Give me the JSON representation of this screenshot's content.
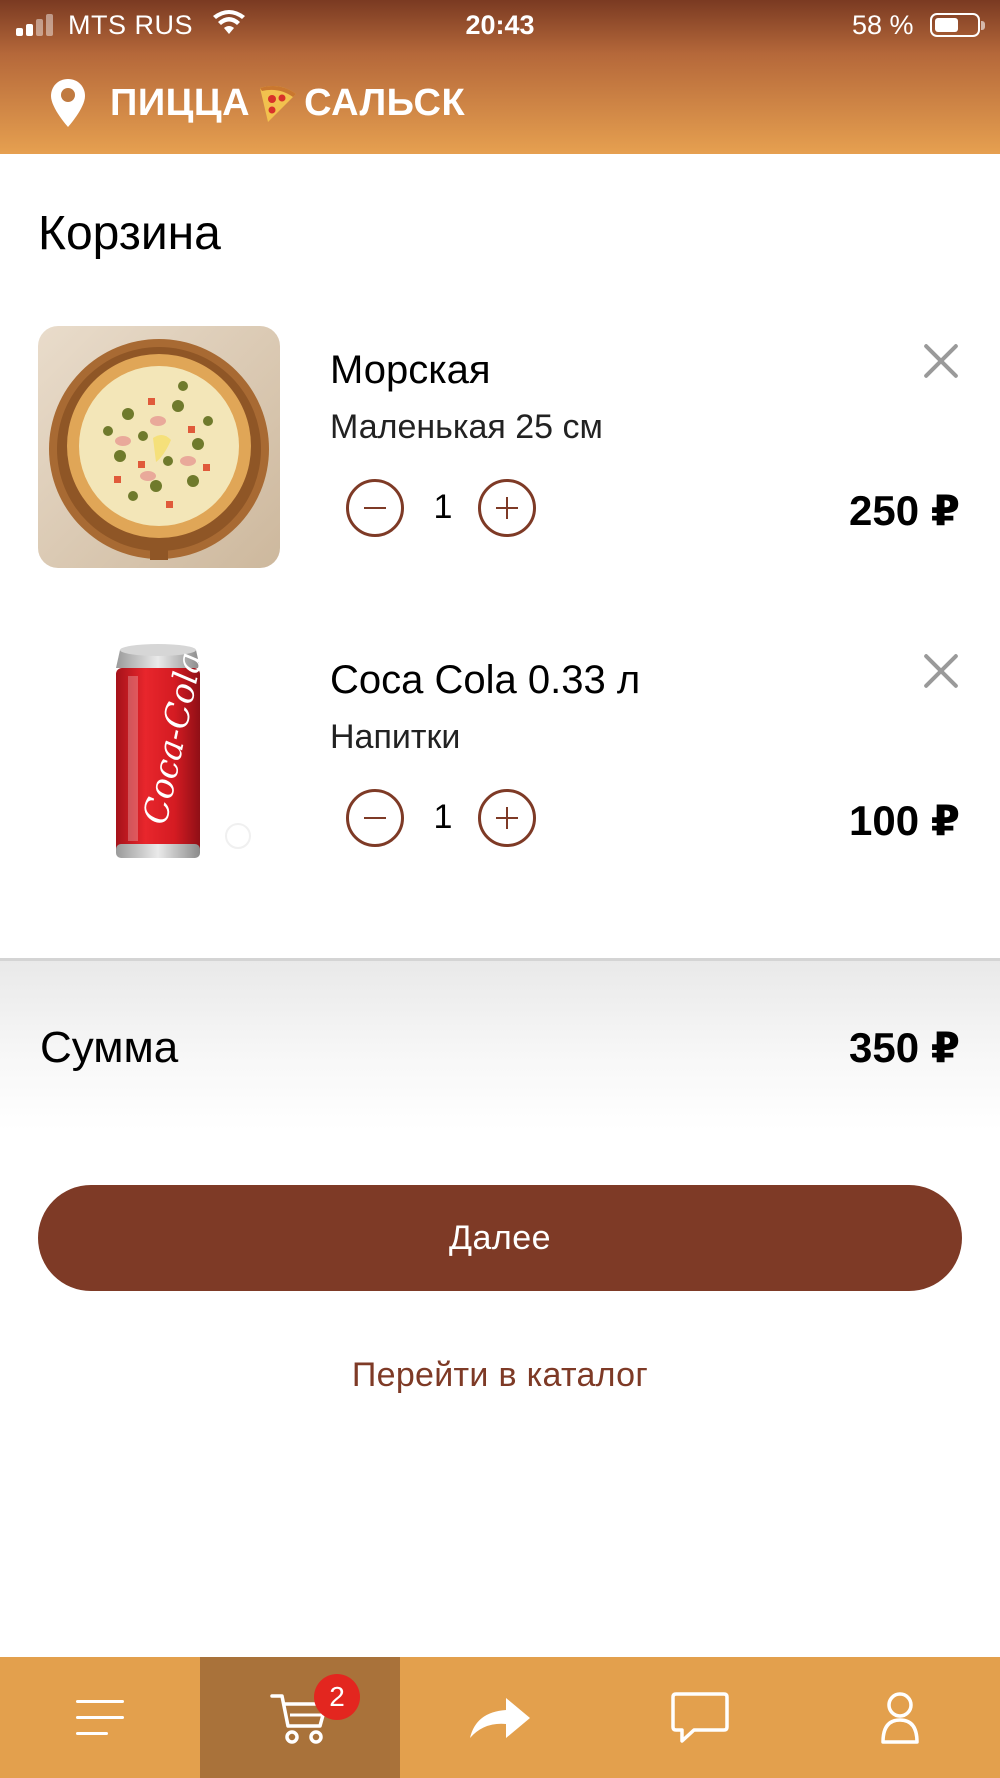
{
  "status_bar": {
    "carrier": "MTS RUS",
    "time": "20:43",
    "battery": "58 %",
    "battery_level": 0.58
  },
  "header": {
    "brand_left": "ПИЦЦА",
    "brand_right": "САЛЬСК",
    "location_icon": "location-pin-icon",
    "brand_icon": "pizza-slice-icon"
  },
  "page": {
    "title": "Корзина"
  },
  "cart": {
    "items": [
      {
        "name": "Морская",
        "subtitle": "Маленькая 25 см",
        "quantity": "1",
        "price": "250 ₽",
        "image": "pizza-photo"
      },
      {
        "name": "Coca Cola 0.33 л",
        "subtitle": "Напитки",
        "quantity": "1",
        "price": "100 ₽",
        "image": "coca-cola-can-photo"
      }
    ]
  },
  "summary": {
    "label": "Сумма",
    "total": "350 ₽"
  },
  "actions": {
    "next_label": "Далее",
    "catalog_label": "Перейти в каталог"
  },
  "tabbar": {
    "cart_badge": "2",
    "tabs": [
      "menu-icon",
      "cart-icon",
      "share-icon",
      "chat-icon",
      "profile-icon"
    ],
    "active": "cart-icon"
  },
  "colors": {
    "accent": "#7e3a26",
    "tabbar": "#e3a04d",
    "tabbar_active": "#a9723a",
    "badge": "#e3261f",
    "coca_cola_logo_text": "Coca-Cola"
  }
}
